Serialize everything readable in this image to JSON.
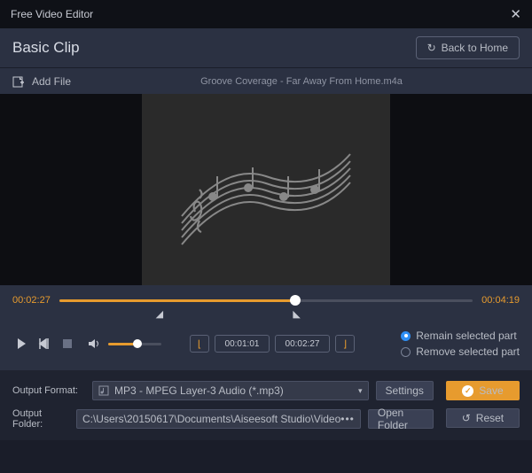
{
  "window": {
    "title": "Free Video Editor"
  },
  "header": {
    "title": "Basic Clip",
    "back_label": "Back to Home"
  },
  "addbar": {
    "add_label": "Add File",
    "filename": "Groove Coverage - Far Away From Home.m4a"
  },
  "timeline": {
    "current": "00:02:27",
    "total": "00:04:19",
    "progress_pct": 57,
    "bracket_start_pct": 23,
    "bracket_end_pct": 57
  },
  "controls": {
    "volume_pct": 55,
    "start_time": "00:01:01",
    "end_time": "00:02:27",
    "radio_remain": "Remain selected part",
    "radio_remove": "Remove selected part",
    "radio_selected": "remain"
  },
  "output": {
    "format_label": "Output Format:",
    "format_value": "MP3 - MPEG Layer-3 Audio (*.mp3)",
    "settings_label": "Settings",
    "folder_label": "Output Folder:",
    "folder_value": "C:\\Users\\20150617\\Documents\\Aiseesoft Studio\\Video",
    "open_folder_label": "Open Folder",
    "save_label": "Save",
    "reset_label": "Reset"
  }
}
